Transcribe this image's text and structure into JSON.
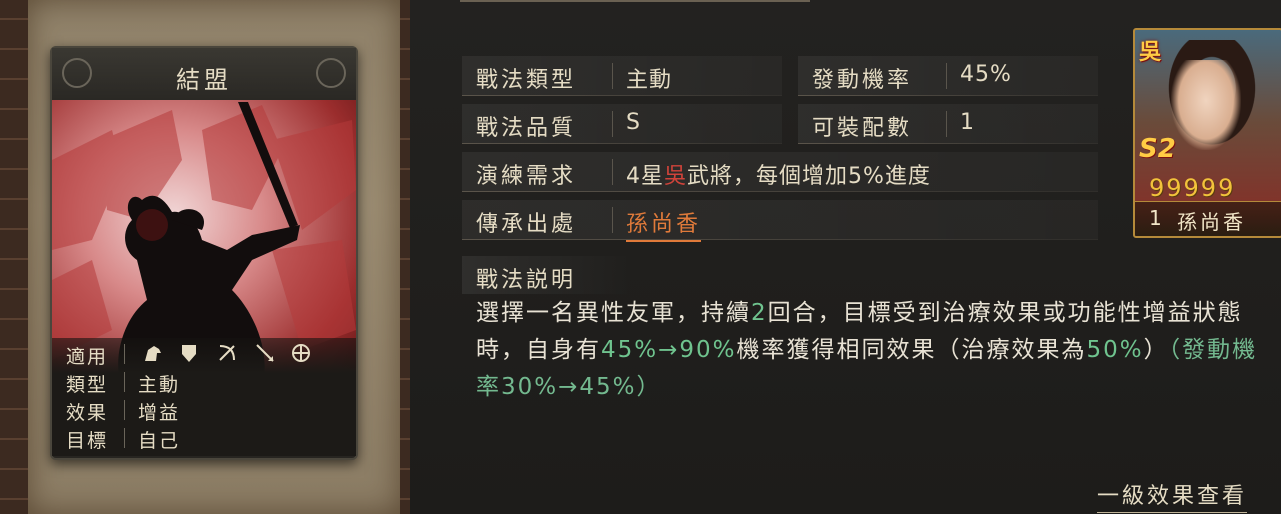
{
  "card": {
    "title": "結盟",
    "rows": [
      {
        "label": "適用",
        "value": ""
      },
      {
        "label": "類型",
        "value": "主動"
      },
      {
        "label": "效果",
        "value": "增益"
      },
      {
        "label": "目標",
        "value": "自己"
      }
    ],
    "troop_icons": [
      "cavalry-icon",
      "shield-icon",
      "bow-icon",
      "spear-icon",
      "wheel-icon"
    ]
  },
  "fields": {
    "type_label": "戰法類型",
    "type_value": "主動",
    "rate_label": "發動機率",
    "rate_value": "45%",
    "quality_label": "戰法品質",
    "quality_value": "S",
    "slots_label": "可裝配數",
    "slots_value": "1",
    "req_label": "演練需求",
    "req_prefix": "4星",
    "req_faction": "吳",
    "req_suffix": "武將，每個增加5%進度",
    "source_label": "傳承出處",
    "source_value": "孫尚香"
  },
  "description": {
    "title": "戰法説明",
    "p1": "選擇一名異性友軍，持續",
    "p1_green": "2",
    "p2": "回合，目標受到治療效果或功能性增益狀態時，自身有",
    "p2_green": "45%→90%",
    "p3": "機率獲得相同效果（治療效果為",
    "p3_green": "50%",
    "p4": "）",
    "p5_green": "（發動機率30%→45%）"
  },
  "hero": {
    "faction": "吳",
    "season": "S2",
    "stars": "99999",
    "level": "1",
    "name": "孫尚香"
  },
  "bottom_link": "一級效果查看",
  "colors": {
    "accent_orange": "#e07a3a",
    "faction_red": "#d0433a",
    "value_green": "#6fc38e"
  }
}
